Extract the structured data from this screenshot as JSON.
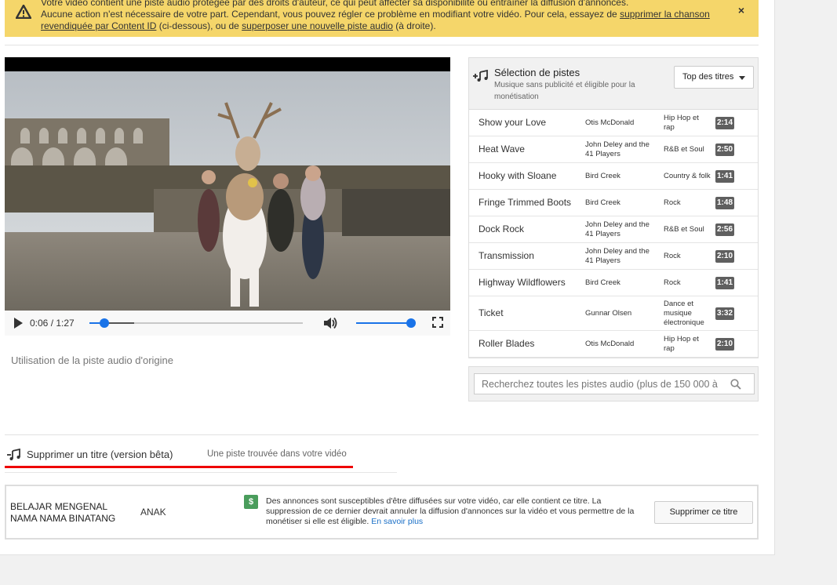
{
  "banner": {
    "line1": "Votre vidéo contient une piste audio protégée par des droits d'auteur, ce qui peut affecter sa disponibilité ou entraîner la diffusion d'annonces.",
    "line2_pre": "Aucune action n'est nécessaire de votre part. Cependant, vous pouvez régler ce problème en modifiant votre vidéo. Pour cela, essayez de ",
    "link1": "supprimer la chanson revendiquée par Content ID",
    "mid": " (ci-dessous), ou de ",
    "link2": "superposer une nouvelle piste audio",
    "post": " (à droite).",
    "close": "×"
  },
  "player": {
    "time": "0:06 / 1:27",
    "progress_fraction": 0.069,
    "buffered_fraction": 0.21,
    "volume_fraction": 1.0
  },
  "original_audio_label": "Utilisation de la piste audio d'origine",
  "tracks": {
    "title": "Sélection de pistes",
    "subtitle": "Musique sans publicité et éligible pour la monétisation",
    "sort_label": "Top des titres",
    "items": [
      {
        "title": "Show your Love",
        "artist": "Otis McDonald",
        "genre": "Hip Hop et rap",
        "duration": "2:14"
      },
      {
        "title": "Heat Wave",
        "artist": "John Deley and the 41 Players",
        "genre": "R&B et Soul",
        "duration": "2:50"
      },
      {
        "title": "Hooky with Sloane",
        "artist": "Bird Creek",
        "genre": "Country & folk",
        "duration": "1:41"
      },
      {
        "title": "Fringe Trimmed Boots",
        "artist": "Bird Creek",
        "genre": "Rock",
        "duration": "1:48"
      },
      {
        "title": "Dock Rock",
        "artist": "John Deley and the 41 Players",
        "genre": "R&B et Soul",
        "duration": "2:56"
      },
      {
        "title": "Transmission",
        "artist": "John Deley and the 41 Players",
        "genre": "Rock",
        "duration": "2:10"
      },
      {
        "title": "Highway Wildflowers",
        "artist": "Bird Creek",
        "genre": "Rock",
        "duration": "1:41"
      },
      {
        "title": "Ticket",
        "artist": "Gunnar Olsen",
        "genre": "Dance et musique électronique",
        "duration": "3:32"
      },
      {
        "title": "Roller Blades",
        "artist": "Otis McDonald",
        "genre": "Hip Hop et rap",
        "duration": "2:10"
      }
    ],
    "search_placeholder": "Recherchez toutes les pistes audio (plus de 150 000 à"
  },
  "remove": {
    "tab_label": "Supprimer un titre (version bêta)",
    "found_label": "Une piste trouvée dans votre vidéo",
    "song_name": "BELAJAR MENGENAL NAMA NAMA BINATANG",
    "artist": "ANAK",
    "dollar": "$",
    "description": "Des annonces sont susceptibles d'être diffusées sur votre vidéo, car elle contient ce titre. La suppression de ce dernier devrait annuler la diffusion d'annonces sur la vidéo et vous permettre de la monétiser si elle est éligible. ",
    "learn_more": "En savoir plus",
    "button": "Supprimer ce titre"
  },
  "colors": {
    "banner": "#f5d66a",
    "accent_blue": "#1a73e8",
    "tab_underline": "#ee0000",
    "dollar_green": "#4a9d5c"
  },
  "icons": [
    "warning-icon",
    "close-icon",
    "play-icon",
    "volume-icon",
    "fullscreen-icon",
    "music-add-icon",
    "search-icon",
    "music-remove-icon",
    "dollar-icon"
  ]
}
